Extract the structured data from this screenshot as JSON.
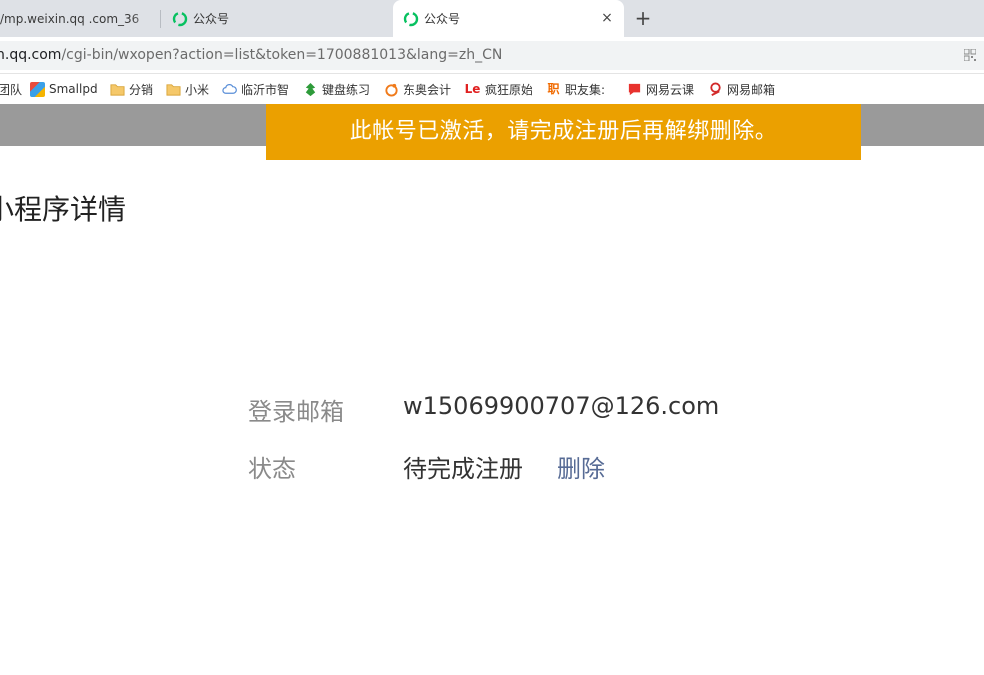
{
  "browser": {
    "tabs": [
      {
        "label": "/mp.weixin.qq .com_36",
        "active": false
      },
      {
        "label": "公众号",
        "active": false
      },
      {
        "label": "公众号",
        "active": true
      }
    ],
    "new_tab_symbol": "+",
    "close_symbol": "×",
    "url_host": "n.qq.com",
    "url_path": "/cgi-bin/wxopen?action=list&token=1700881013&lang=zh_CN",
    "bookmarks": [
      {
        "label": "团队",
        "icon": "none"
      },
      {
        "label": "Smallpd",
        "icon": "smallpdf-icon"
      },
      {
        "label": "分销",
        "icon": "folder-icon"
      },
      {
        "label": "小米",
        "icon": "folder-icon"
      },
      {
        "label": "临沂市智",
        "icon": "cloud-icon"
      },
      {
        "label": "键盘练习",
        "icon": "keyboard-practice-icon"
      },
      {
        "label": "东奥会计",
        "icon": "dongao-icon"
      },
      {
        "label": "疯狂原始",
        "icon": "le-icon",
        "badge": "Le"
      },
      {
        "label": "职友集:",
        "icon": "zhiyouji-icon",
        "badge": "职"
      },
      {
        "label": "网易云课",
        "icon": "netease-class-icon"
      },
      {
        "label": "网易邮箱",
        "icon": "netease-mail-icon"
      }
    ]
  },
  "colors": {
    "banner_bg": "#eba000",
    "link": "#576b95",
    "wechat_green": "#07c160"
  },
  "page": {
    "banner_text": "此帐号已激活，请完成注册后再解绑删除。",
    "title": "小程序详情",
    "email_label": "登录邮箱",
    "email_value": "w15069900707@126.com",
    "status_label": "状态",
    "status_value": "待完成注册",
    "delete_link": "删除"
  }
}
